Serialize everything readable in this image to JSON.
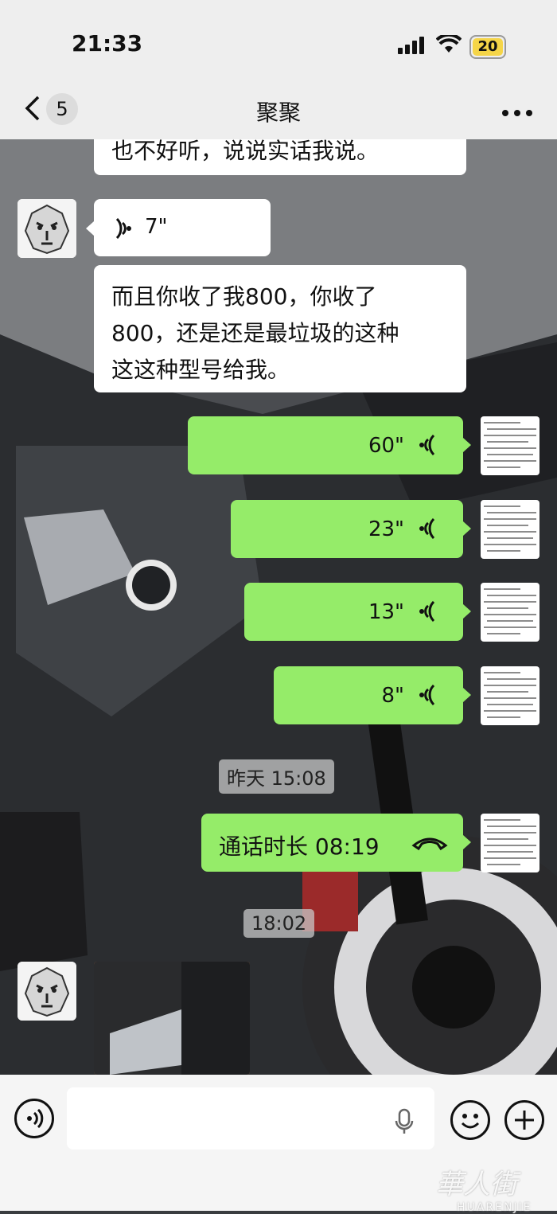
{
  "status": {
    "time": "21:33",
    "battery": "20"
  },
  "nav": {
    "unread": "5",
    "title": "聚聚"
  },
  "messages": [
    {
      "text_partial": "也不好听，说说实话我说。"
    },
    {
      "voice_duration": "7\""
    },
    {
      "text": "而且你收了我800，你收了800，还是还是最垃圾的这种这这种型号给我。"
    },
    {
      "voice_duration": "60\""
    },
    {
      "voice_duration": "23\""
    },
    {
      "voice_duration": "13\""
    },
    {
      "voice_duration": "8\""
    },
    {
      "timestamp": "昨天 15:08"
    },
    {
      "call": "通话时长 08:19"
    },
    {
      "timestamp": "18:02"
    }
  ],
  "lines": {
    "m3_line1": "而且你收了我800，你收了",
    "m3_line2": "800，还是还是最垃圾的这种",
    "m3_line3": "这这种型号给我。"
  },
  "watermark": {
    "cn": "華人街",
    "en": "HUARENJIE"
  },
  "colors": {
    "green_bubble": "#95ec69",
    "white_bubble": "#ffffff",
    "bar_bg": "#eeeeee"
  },
  "icons": [
    "back-chevron-icon",
    "more-icon",
    "voice-wave-icon",
    "phone-icon",
    "mic-icon",
    "emoji-icon",
    "plus-icon",
    "voice-input-icon",
    "signal-icon",
    "wifi-icon",
    "battery-icon"
  ]
}
